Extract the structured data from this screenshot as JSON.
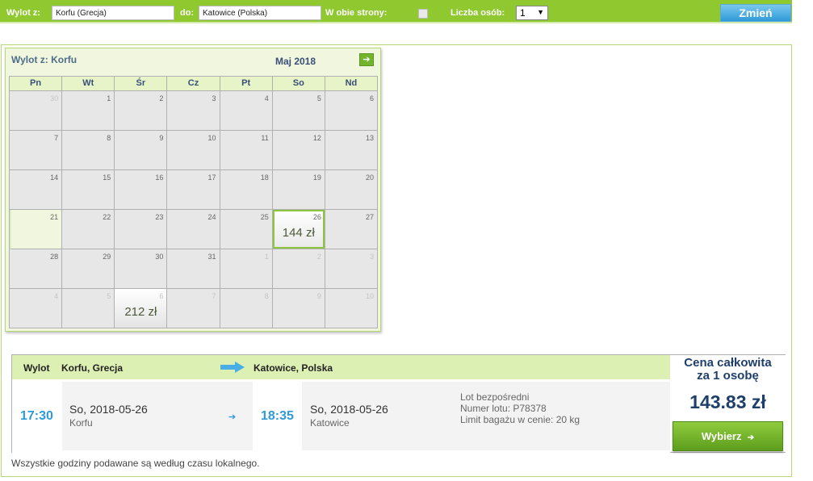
{
  "search": {
    "from_label": "Wylot z:",
    "from_value": "Korfu (Grecja)",
    "to_label": "do:",
    "to_value": "Katowice (Polska)",
    "roundtrip_label": "W obie strony:",
    "roundtrip_checked": false,
    "persons_label": "Liczba osób:",
    "persons_value": "1",
    "change_label": "Zmień"
  },
  "calendar": {
    "from_prefix": "Wylot z:",
    "from_city": "Korfu",
    "month": "Maj 2018",
    "weekdays": [
      "Pn",
      "Wt",
      "Śr",
      "Cz",
      "Pt",
      "So",
      "Nd"
    ],
    "weeks": [
      [
        {
          "d": "30",
          "other": true
        },
        {
          "d": "1"
        },
        {
          "d": "2"
        },
        {
          "d": "3"
        },
        {
          "d": "4"
        },
        {
          "d": "5"
        },
        {
          "d": "6"
        }
      ],
      [
        {
          "d": "7"
        },
        {
          "d": "8"
        },
        {
          "d": "9"
        },
        {
          "d": "10"
        },
        {
          "d": "11"
        },
        {
          "d": "12"
        },
        {
          "d": "13"
        }
      ],
      [
        {
          "d": "14"
        },
        {
          "d": "15"
        },
        {
          "d": "16"
        },
        {
          "d": "17"
        },
        {
          "d": "18"
        },
        {
          "d": "19"
        },
        {
          "d": "20"
        }
      ],
      [
        {
          "d": "21",
          "today": true
        },
        {
          "d": "22"
        },
        {
          "d": "23"
        },
        {
          "d": "24"
        },
        {
          "d": "25"
        },
        {
          "d": "26",
          "price": "144 zł",
          "selected": true
        },
        {
          "d": "27"
        }
      ],
      [
        {
          "d": "28"
        },
        {
          "d": "29"
        },
        {
          "d": "30"
        },
        {
          "d": "31"
        },
        {
          "d": "1",
          "other": true
        },
        {
          "d": "2",
          "other": true
        },
        {
          "d": "3",
          "other": true
        }
      ],
      [
        {
          "d": "4",
          "other": true
        },
        {
          "d": "5",
          "other": true
        },
        {
          "d": "6",
          "other": true,
          "price": "212 zł"
        },
        {
          "d": "7",
          "other": true
        },
        {
          "d": "8",
          "other": true
        },
        {
          "d": "9",
          "other": true
        },
        {
          "d": "10",
          "other": true
        }
      ]
    ]
  },
  "flight": {
    "header_label": "Wylot",
    "origin": "Korfu, Grecja",
    "destination": "Katowice, Polska",
    "depart_time": "17:30",
    "depart_day": "So,",
    "depart_date": "2018-05-26",
    "depart_city": "Korfu",
    "arrive_time": "18:35",
    "arrive_day": "So,",
    "arrive_date": "2018-05-26",
    "arrive_city": "Katowice",
    "info_direct": "Lot bezpośredni",
    "info_flight_no": "Numer lotu: P78378",
    "info_baggage": "Limit bagażu w cenie: 20 kg",
    "price_title_1": "Cena całkowita",
    "price_title_2": "za 1 osobę",
    "price": "143.83 zł",
    "choose_label": "Wybierz",
    "choose_arrow": "➔"
  },
  "footnote": "Wszystkie godziny podawane są według czasu lokalnego.",
  "colors": {
    "brand_green": "#8fc92f",
    "accent_blue": "#2f9ad8",
    "price_navy": "#1f3f6b"
  },
  "icons": {
    "next_month": "arrow-right-icon",
    "flight_arrow": "arrow-right-icon"
  }
}
